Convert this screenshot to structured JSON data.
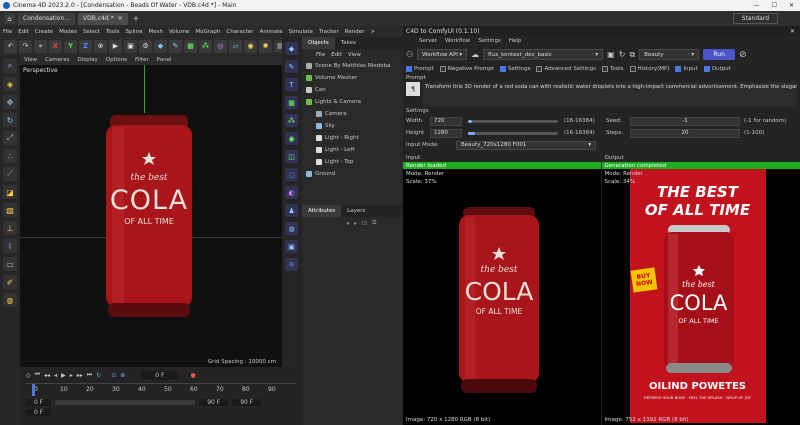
{
  "window": {
    "title": "Cinema 4D 2023.2.0 - [Condensation - Beads Of Water - VDB.c4d *] - Main",
    "minimize": "—",
    "maximize": "☐",
    "close": "✕"
  },
  "tabs": [
    {
      "label": "Condensation..."
    },
    {
      "label": "VDB.c4d *"
    }
  ],
  "layout_label": "Standard",
  "menu": [
    "File",
    "Edit",
    "Create",
    "Modes",
    "Select",
    "Tools",
    "Spline",
    "Mesh",
    "Volume",
    "MoGraph",
    "Character",
    "Animate",
    "Simulate",
    "Tracker",
    "Render",
    ">"
  ],
  "toolbar": {
    "x": "X",
    "y": "Y",
    "z": "Z"
  },
  "viewport": {
    "menu": [
      "View",
      "Cameras",
      "Display",
      "Options",
      "Filter",
      "Panel"
    ],
    "label": "Perspective",
    "grid_spacing": "Grid Spacing : 10000 cm"
  },
  "can": {
    "line1": "the best",
    "line2": "COLA",
    "line3": "OF ALL TIME",
    "colors": {
      "can": "#a8151a",
      "label": "#e9e0d6"
    }
  },
  "timeline": {
    "frame_current": "0 F",
    "ruler": [
      "0",
      "10",
      "20",
      "30",
      "40",
      "50",
      "60",
      "70",
      "80",
      "90"
    ],
    "start": "0 F",
    "start2": "0 F",
    "end": "90 F",
    "end2": "90 F"
  },
  "objects": {
    "tabs": [
      "Objects",
      "Takes"
    ],
    "menu": [
      "File",
      "Edit",
      "View"
    ],
    "items": [
      {
        "label": "Scene By Matthias Niedoba",
        "color": "#aaa",
        "indent": 0
      },
      {
        "label": "Volume Mesher",
        "color": "#6fbf4a",
        "indent": 0
      },
      {
        "label": "Can",
        "color": "#c8c8c8",
        "indent": 0
      },
      {
        "label": "Lights & Camera",
        "color": "#6fbf4a",
        "indent": 0
      },
      {
        "label": "Camera",
        "color": "#9ab",
        "indent": 1
      },
      {
        "label": "Sky",
        "color": "#8bd",
        "indent": 1
      },
      {
        "label": "Light - Right",
        "color": "#ddd",
        "indent": 1
      },
      {
        "label": "Light - Left",
        "color": "#ddd",
        "indent": 1
      },
      {
        "label": "Light - Top",
        "color": "#ddd",
        "indent": 1
      },
      {
        "label": "Ground",
        "color": "#8bd",
        "indent": 0
      }
    ]
  },
  "attributes": {
    "tabs": [
      "Attributes",
      "Layers"
    ]
  },
  "comfy": {
    "title": "C4D to ComfyUI (0.1.10)",
    "menu": [
      "Server",
      "Workflow",
      "Settings",
      "Help"
    ],
    "workflow_source": "Workflow API",
    "workflow_file": "flux_kontext_dev_basic",
    "output_mode": "Beauty",
    "run_label": "Run",
    "checks": [
      {
        "label": "Prompt",
        "on": true
      },
      {
        "label": "Negative Prompt",
        "on": false
      },
      {
        "label": "Settings",
        "on": true
      },
      {
        "label": "Advanced Settings",
        "on": false
      },
      {
        "label": "Tools",
        "on": false
      },
      {
        "label": "History(MP)",
        "on": false
      },
      {
        "label": "Input",
        "on": true
      },
      {
        "label": "Output",
        "on": true
      }
    ],
    "prompt_label": "Prompt",
    "prompt_text": "Transform this 3D render of a red soda can with realistic water droplets into a high-impact commercial advertisement. Emphasize the slogan 'T",
    "settings_label": "Settings",
    "width": {
      "label": "Width",
      "value": "720",
      "range": "(16-16384)",
      "fill": 0.04
    },
    "height": {
      "label": "Height",
      "value": "1280",
      "range": "(16-16384)",
      "fill": 0.08
    },
    "seed": {
      "label": "Seed:",
      "value": "-1",
      "range": "(-1 for random)"
    },
    "steps": {
      "label": "Steps:",
      "value": "20",
      "range": "(1-100)"
    },
    "input_mode": {
      "label": "Input Mode:",
      "value": "Beauty_720x1280 F001"
    },
    "input": {
      "label": "Input",
      "status": "Render loaded",
      "mode": "Mode: Render",
      "scale": "Scale: 37%",
      "footer": "Image: 720 x 1280 RGB (8 bit)"
    },
    "output": {
      "label": "Output",
      "status": "Generation completed",
      "mode": "Mode: Render",
      "scale": "Scale: 34%",
      "footer": "Image: 752 x 1392 RGB (8 bit)"
    },
    "ad": {
      "line1": "THE BEST",
      "line2": "OF ALL TIME",
      "badge1": "BUY",
      "badge2": "NOW",
      "bottom1": "OILIND POWETES",
      "bottom2": "REFRESH YOUR BODY · FEEL THE SPLASH · DROP OF JOY"
    }
  }
}
